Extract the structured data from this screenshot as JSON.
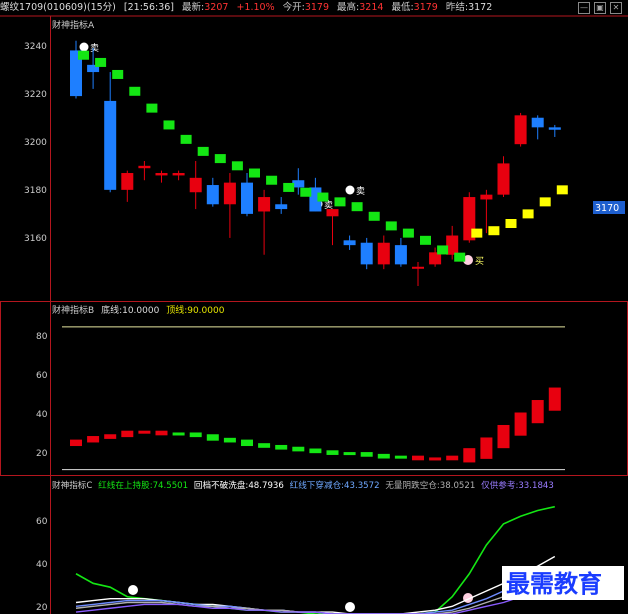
{
  "header": {
    "title": "螺纹1709(010609)",
    "period": "(15分)",
    "time": "[21:56:36]",
    "latest_label": "最新:",
    "latest": "3207",
    "change": "+1.10%",
    "open_label": "今开:",
    "open": "3179",
    "high_label": "最高:",
    "high": "3214",
    "low_label": "最低:",
    "low": "3179",
    "prev_label": "昨结:",
    "prev": "3172",
    "window_controls": [
      "—",
      "▣",
      "✕"
    ]
  },
  "colors": {
    "up": "#e8000f",
    "down": "#1e7fff",
    "green": "#14e614",
    "yellow": "#ffff00",
    "purple": "#8a5cff",
    "white": "#ffffff",
    "frame": "#b3161e"
  },
  "panelA": {
    "name": "财神指标A",
    "price_tag": "3170",
    "sell_label": "卖",
    "buy_label": "买",
    "y_ticks": [
      "3240",
      "3220",
      "3200",
      "3180",
      "3160"
    ]
  },
  "panelB": {
    "name": "财神指标B",
    "low_line": "底线:10.0000",
    "top_line": "顶线:90.0000",
    "y_ticks": [
      "80",
      "60",
      "40",
      "20"
    ]
  },
  "panelC": {
    "name": "财神指标C",
    "legend": [
      {
        "text": "红线在上持股:74.5501",
        "color": "#14e614"
      },
      {
        "text": "回档不破洗盘:48.7936",
        "color": "#ffffff"
      },
      {
        "text": "红线下穿减仓:43.3572",
        "color": "#6fa8ff"
      },
      {
        "text": "无量阴跌空仓:38.0521",
        "color": "#b0b0b0"
      },
      {
        "text": "仅供参考:33.1843",
        "color": "#9a7cff"
      }
    ],
    "y_ticks": [
      "60",
      "40",
      "20"
    ]
  },
  "watermark": "最需教育",
  "chart_data": [
    {
      "type": "candlestick",
      "title": "财神指标A",
      "ylim": [
        3142,
        3246
      ],
      "candles": [
        {
          "o": 3240,
          "h": 3244,
          "l": 3220,
          "c": 3221
        },
        {
          "o": 3234,
          "h": 3241,
          "l": 3224,
          "c": 3231
        },
        {
          "o": 3219,
          "h": 3231,
          "l": 3181,
          "c": 3182
        },
        {
          "o": 3182,
          "h": 3190,
          "l": 3177,
          "c": 3189
        },
        {
          "o": 3191,
          "h": 3194,
          "l": 3186,
          "c": 3192
        },
        {
          "o": 3188,
          "h": 3190,
          "l": 3185,
          "c": 3189
        },
        {
          "o": 3188,
          "h": 3190,
          "l": 3186,
          "c": 3189
        },
        {
          "o": 3181,
          "h": 3194,
          "l": 3174,
          "c": 3187
        },
        {
          "o": 3184,
          "h": 3187,
          "l": 3175,
          "c": 3176
        },
        {
          "o": 3176,
          "h": 3189,
          "l": 3162,
          "c": 3185
        },
        {
          "o": 3185,
          "h": 3189,
          "l": 3171,
          "c": 3172
        },
        {
          "o": 3173,
          "h": 3182,
          "l": 3155,
          "c": 3179
        },
        {
          "o": 3176,
          "h": 3179,
          "l": 3172,
          "c": 3174
        },
        {
          "o": 3186,
          "h": 3191,
          "l": 3180,
          "c": 3183
        },
        {
          "o": 3183,
          "h": 3187,
          "l": 3173,
          "c": 3173
        },
        {
          "o": 3171,
          "h": 3174,
          "l": 3159,
          "c": 3174
        },
        {
          "o": 3161,
          "h": 3163,
          "l": 3157,
          "c": 3159
        },
        {
          "o": 3160,
          "h": 3162,
          "l": 3149,
          "c": 3151
        },
        {
          "o": 3151,
          "h": 3163,
          "l": 3149,
          "c": 3160
        },
        {
          "o": 3159,
          "h": 3162,
          "l": 3150,
          "c": 3151
        },
        {
          "o": 3150,
          "h": 3152,
          "l": 3142,
          "c": 3150
        },
        {
          "o": 3151,
          "h": 3158,
          "l": 3150,
          "c": 3156
        },
        {
          "o": 3155,
          "h": 3167,
          "l": 3153,
          "c": 3163
        },
        {
          "o": 3161,
          "h": 3181,
          "l": 3160,
          "c": 3179
        },
        {
          "o": 3178,
          "h": 3182,
          "l": 3164,
          "c": 3180
        },
        {
          "o": 3180,
          "h": 3196,
          "l": 3179,
          "c": 3193
        },
        {
          "o": 3201,
          "h": 3214,
          "l": 3200,
          "c": 3213
        },
        {
          "o": 3212,
          "h": 3213,
          "l": 3203,
          "c": 3208
        },
        {
          "o": 3208,
          "h": 3209,
          "l": 3204,
          "c": 3207
        }
      ],
      "support_line": {
        "values": [
          3238,
          3235,
          3230,
          3223,
          3216,
          3209,
          3203,
          3198,
          3195,
          3192,
          3189,
          3186,
          3183,
          3181,
          3179,
          3177,
          3175,
          3171,
          3167,
          3164,
          3161,
          3157,
          3154,
          3164,
          3165,
          3168,
          3172,
          3177,
          3182
        ],
        "color_switch_index": 23
      }
    },
    {
      "type": "bar",
      "title": "财神指标B",
      "ylim": [
        12,
        95
      ],
      "reference_lines": [
        10,
        90
      ],
      "values": [
        26,
        28,
        29,
        31,
        31,
        30,
        30,
        29,
        27,
        26,
        24,
        23,
        22,
        21,
        20,
        19,
        19,
        18,
        17,
        17,
        16,
        16,
        17,
        19,
        25,
        32,
        39,
        46,
        53
      ]
    },
    {
      "type": "line",
      "title": "财神指标C",
      "ylim": [
        19,
        79
      ],
      "series": [
        {
          "name": "红线在上持股",
          "values": [
            40,
            35,
            33,
            28,
            27,
            26,
            25,
            24,
            23,
            22,
            21,
            21,
            20,
            20,
            19,
            19,
            19,
            19,
            19,
            19,
            19,
            20,
            28,
            40,
            55,
            66,
            70,
            73,
            75
          ]
        },
        {
          "name": "回档不破洗盘",
          "values": [
            25,
            26,
            27,
            27,
            27,
            26,
            25,
            24,
            24,
            23,
            22,
            21,
            21,
            20,
            20,
            20,
            19,
            19,
            19,
            19,
            20,
            21,
            23,
            27,
            31,
            35,
            40,
            44,
            49
          ]
        },
        {
          "name": "红线下穿减仓",
          "values": [
            23,
            24,
            25,
            26,
            26,
            26,
            25,
            24,
            23,
            23,
            22,
            21,
            21,
            20,
            20,
            19,
            19,
            19,
            19,
            19,
            19,
            20,
            21,
            24,
            27,
            31,
            35,
            39,
            43
          ]
        },
        {
          "name": "无量阴跌空仓",
          "values": [
            22,
            23,
            24,
            25,
            25,
            25,
            24,
            23,
            23,
            22,
            22,
            21,
            21,
            20,
            20,
            19,
            19,
            19,
            19,
            19,
            19,
            19,
            20,
            22,
            25,
            28,
            32,
            35,
            38
          ]
        },
        {
          "name": "仅供参考",
          "values": [
            20,
            21,
            22,
            23,
            24,
            24,
            24,
            23,
            22,
            22,
            21,
            21,
            20,
            20,
            20,
            19,
            19,
            19,
            19,
            19,
            19,
            19,
            19,
            21,
            23,
            25,
            28,
            30,
            33
          ]
        }
      ]
    }
  ]
}
